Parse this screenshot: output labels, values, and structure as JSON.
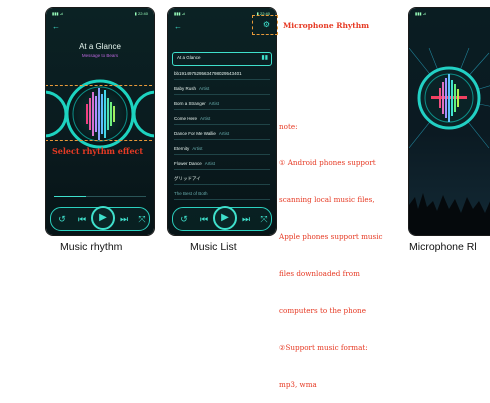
{
  "screen1": {
    "title": "At a Glance",
    "subtitle": "Message to Bears",
    "caption": "Select rhythm effect",
    "controls": [
      "↺",
      "⏮",
      "▶",
      "⏭",
      "⤧"
    ]
  },
  "screen2": {
    "header": "At a Glance",
    "rows": [
      {
        "title": "bb1914975295634798029543401",
        "sub": ""
      },
      {
        "title": "Baby Rush",
        "sub": "Artist"
      },
      {
        "title": "Born a Stranger",
        "sub": "Artist"
      },
      {
        "title": "Come Here",
        "sub": "Artist"
      },
      {
        "title": "Dance For Me Wallie",
        "sub": "Artist"
      },
      {
        "title": "Eternity",
        "sub": "Artist"
      },
      {
        "title": "Flower Dance",
        "sub": "Artist"
      },
      {
        "title": "グリッドアイ",
        "sub": ""
      },
      {
        "title": "The Best of Both",
        "sub": ""
      }
    ],
    "controls": [
      "↺",
      "⏮",
      "▶",
      "⏭",
      "⤧"
    ]
  },
  "mic_label": "Microphone Rhythm",
  "note_lines": [
    "note:",
    "① Android phones support",
    "scanning local music files,",
    "Apple phones support music",
    "files downloaded from",
    "computers to the phone",
    "②Support music format:",
    "mp3, wma"
  ],
  "bottom_labels": {
    "music_rhythm": "Music rhythm",
    "music_list": "Music List",
    "microphone": "Microphone Rl"
  },
  "colors": {
    "accent": "#3fe0cc",
    "note_red": "#e63a24",
    "highlight": "#e89a3a"
  }
}
